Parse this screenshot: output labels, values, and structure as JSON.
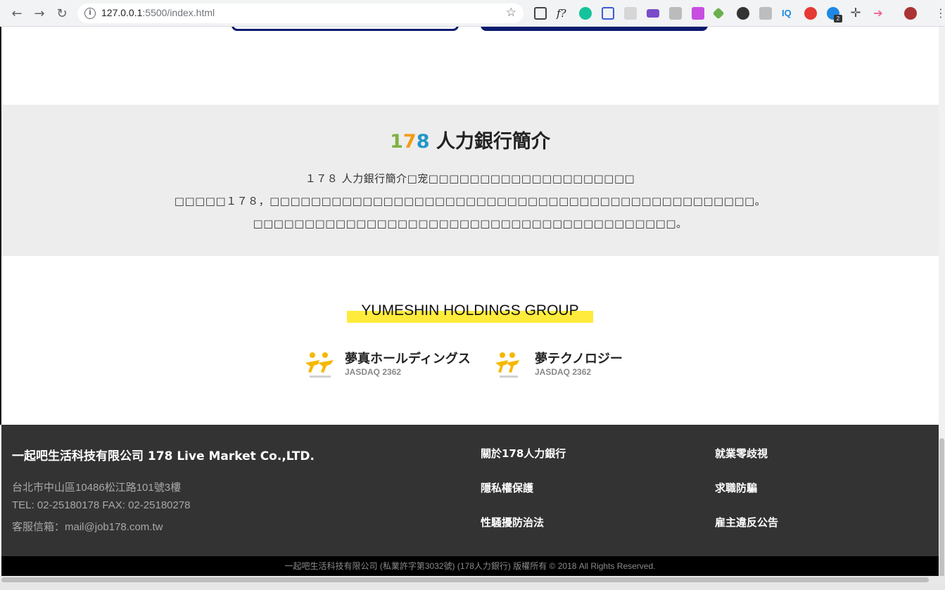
{
  "browser": {
    "url_host": "127.0.0.1",
    "url_rest": ":5500/index.html",
    "extension_badge": "2"
  },
  "intro": {
    "title_digits": [
      "1",
      "7",
      "8"
    ],
    "title_text": "人力銀行簡介",
    "lines": [
      "１７８ 人力銀行簡介□宠□□□□□□□□□□□□□□□□□□□□",
      "□□□□□１７８，□□□□□□□□□□□□□□□□□□□□□□□□□□□□□□□□□□□□□□□□□□□□□□□。",
      "□□□□□□□□□□□□□□□□□□□□□□□□□□□□□□□□□□□□□□□□□。"
    ]
  },
  "group": {
    "title": "YUMESHIN HOLDINGS GROUP",
    "companies": [
      {
        "name": "夢真ホールディングス",
        "code": "JASDAQ 2362"
      },
      {
        "name": "夢テクノロジー",
        "code": "JASDAQ 2362"
      }
    ]
  },
  "footer": {
    "company_name": "一起吧生活科技有限公司 178 Live Market Co.,LTD.",
    "address": "台北市中山區10486松江路101號3樓",
    "phone": "TEL: 02-25180178 FAX: 02-25180278",
    "email": "客服信箱：mail@job178.com.tw",
    "links_col1": [
      "關於178人力銀行",
      "隱私權保護",
      "性騷擾防治法"
    ],
    "links_col2": [
      "就業零歧視",
      "求職防騙",
      "雇主違反公告"
    ]
  },
  "copyright": "一起吧生活科技有限公司 (私業許字第3032號) (178人力銀行) 版權所有 © 2018 All Rights Reserved.",
  "colors": {
    "navy": "#0d1b6e",
    "digit1": "#7cb342",
    "digit7": "#f39c12",
    "digit8": "#2196c9",
    "highlight": "#ffeb3b",
    "footer_bg": "#333333"
  }
}
